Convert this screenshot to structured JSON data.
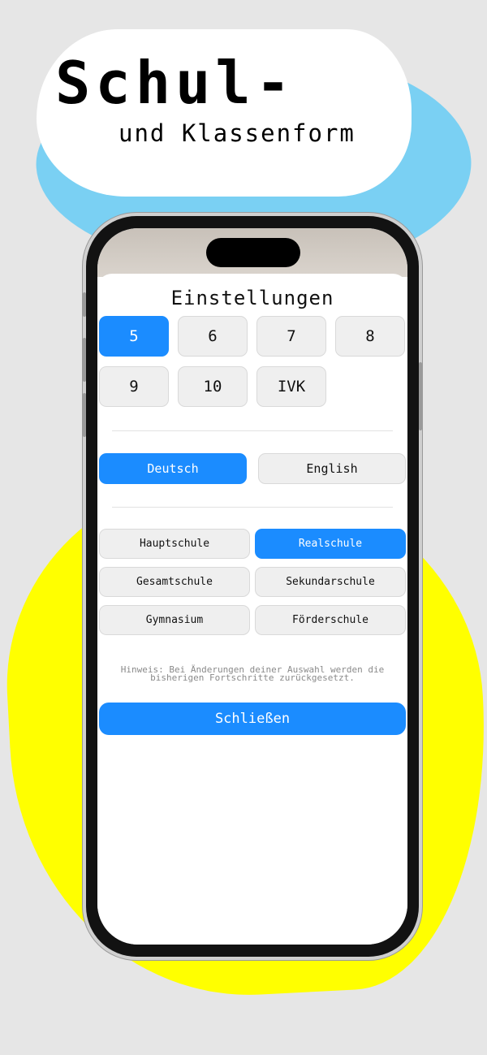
{
  "promo": {
    "title_line1": "Schul-",
    "title_line2": "und Klassenform"
  },
  "settings": {
    "title": "Einstellungen",
    "grades": [
      {
        "label": "5",
        "selected": true
      },
      {
        "label": "6",
        "selected": false
      },
      {
        "label": "7",
        "selected": false
      },
      {
        "label": "8",
        "selected": false
      },
      {
        "label": "9",
        "selected": false
      },
      {
        "label": "10",
        "selected": false
      },
      {
        "label": "IVK",
        "selected": false
      }
    ],
    "languages": [
      {
        "label": "Deutsch",
        "selected": true
      },
      {
        "label": "English",
        "selected": false
      }
    ],
    "school_types": [
      {
        "label": "Hauptschule",
        "selected": false
      },
      {
        "label": "Realschule",
        "selected": true
      },
      {
        "label": "Gesamtschule",
        "selected": false
      },
      {
        "label": "Sekundarschule",
        "selected": false
      },
      {
        "label": "Gymnasium",
        "selected": false
      },
      {
        "label": "Förderschule",
        "selected": false
      }
    ],
    "hint": "Hinweis: Bei Änderungen deiner Auswahl werden die bisherigen Fortschritte zurückgesetzt.",
    "close_label": "Schließen"
  },
  "colors": {
    "accent": "#1b8cff",
    "blob_blue": "#7ad0f3",
    "blob_yellow": "#ffff00",
    "background": "#e6e6e6"
  }
}
